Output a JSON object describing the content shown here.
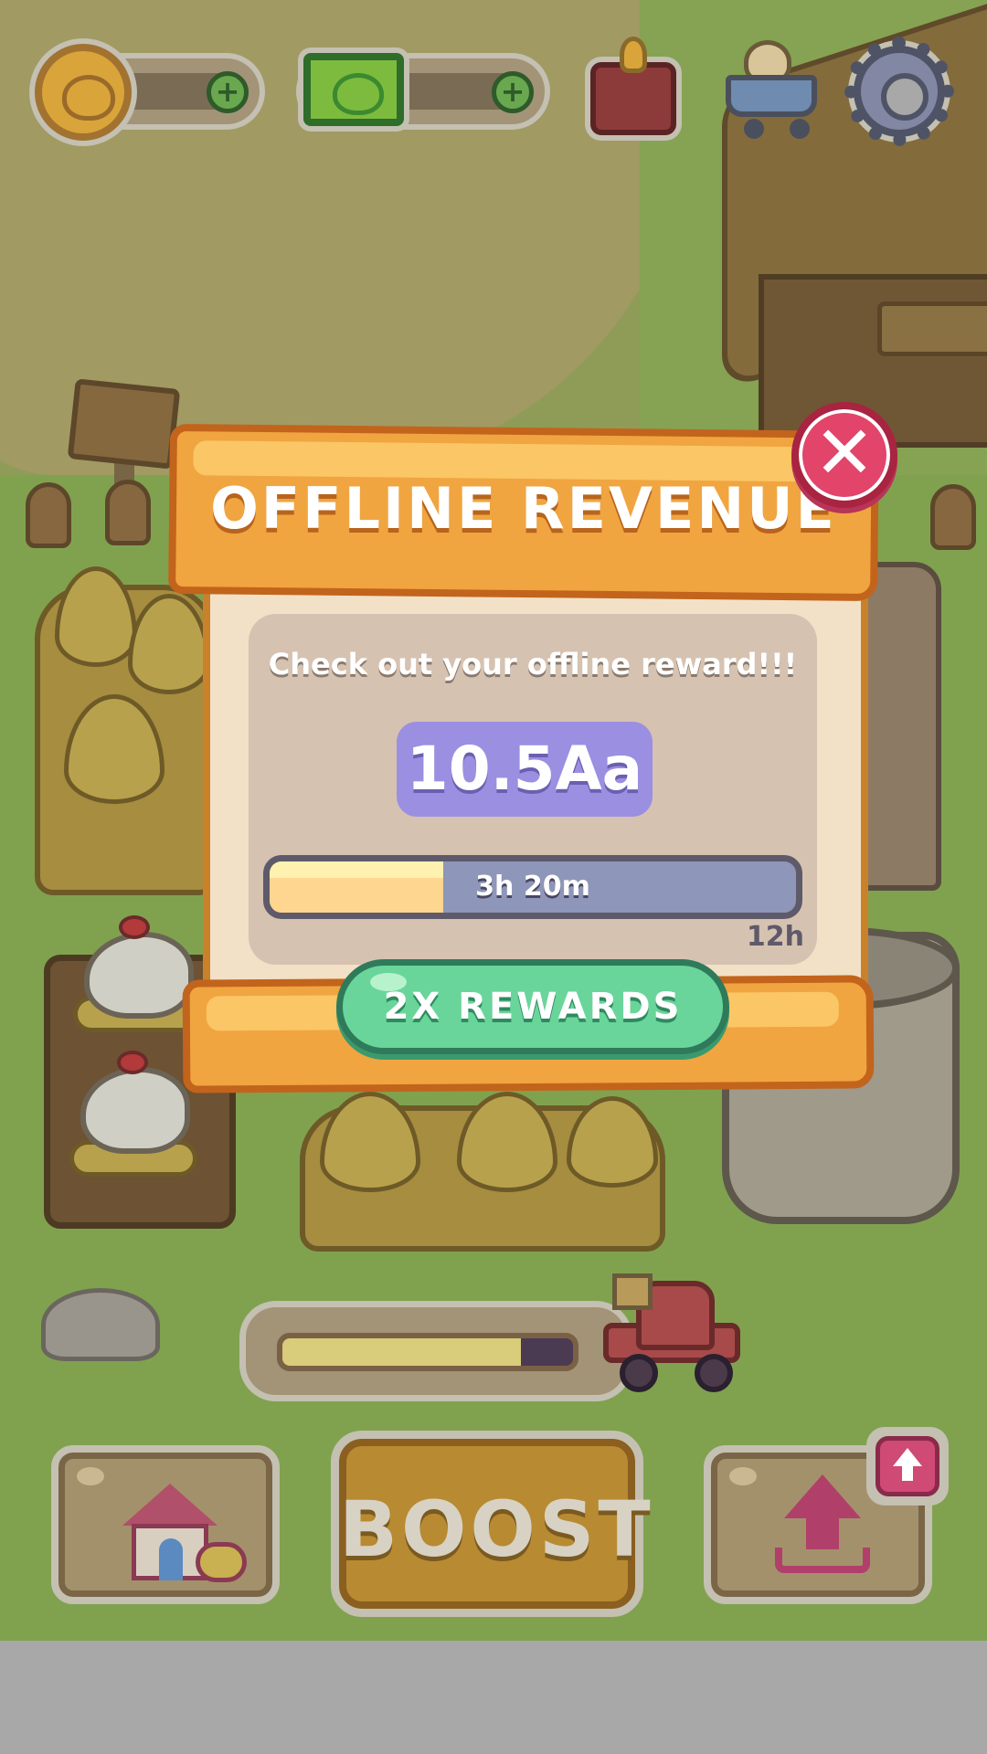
{
  "hud": {
    "coin_add_label": "+",
    "cash_add_label": "+",
    "icons": [
      "coin-icon",
      "cash-icon",
      "gift-icon",
      "shop-cart-icon",
      "settings-gear-icon"
    ]
  },
  "dialog": {
    "title": "OFFLINE REVENUE",
    "close_label": "✕",
    "subtitle": "Check out your offline reward!!!",
    "reward_amount": "10.5Aa",
    "timer": {
      "elapsed": "3h 20m",
      "max": "12h",
      "progress_fraction": 0.33
    },
    "rewards_button": "2X REWARDS"
  },
  "truck_progress": {
    "progress_fraction": 0.82
  },
  "bottom_bar": {
    "boost_label": "BOOST",
    "home_icon": "farmhouse-icon",
    "upgrade_icon": "upgrade-arrow-icon"
  },
  "colors": {
    "dialog_plank": "#f0a540",
    "reward_pill": "#9b8fe2",
    "rewards_button": "#69d59a",
    "close_button": "#e2446a"
  }
}
